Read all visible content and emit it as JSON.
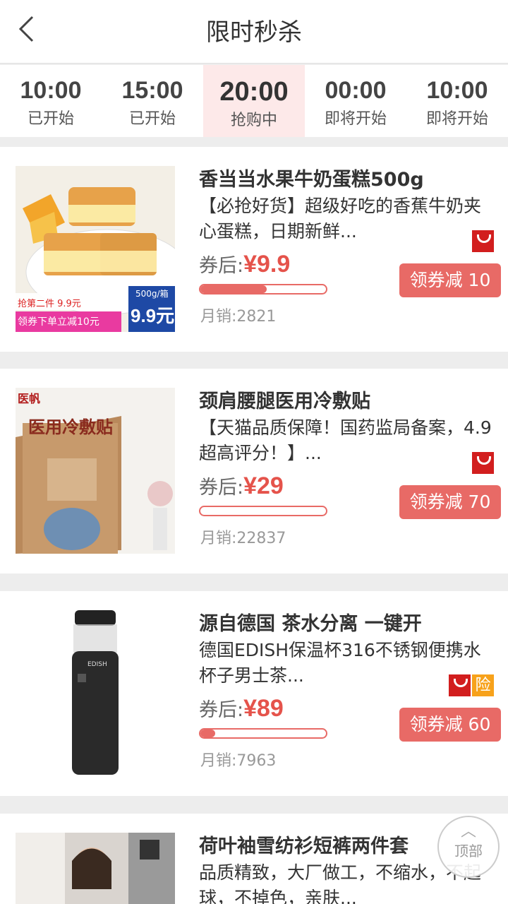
{
  "header": {
    "title": "限时秒杀"
  },
  "tabs": [
    {
      "time": "10:00",
      "status": "已开始"
    },
    {
      "time": "15:00",
      "status": "已开始"
    },
    {
      "time": "20:00",
      "status": "抢购中"
    },
    {
      "time": "00:00",
      "status": "即将开始"
    },
    {
      "time": "10:00",
      "status": "即将开始"
    }
  ],
  "products": [
    {
      "name": "香当当水果牛奶蛋糕500g",
      "desc": "【必抢好货】超级好吃的香蕉牛奶夹心蛋糕，日期新鲜...",
      "price_prefix": "券后:",
      "price": "¥9.9",
      "sales": "月销:2821",
      "coupon": "领券减 10",
      "progress": 0.53,
      "img_promo1": "抢第二件 9.9元",
      "img_promo2": "领券下单立减10元",
      "img_box": "500g/箱",
      "img_price": "9.9元"
    },
    {
      "name": "颈肩腰腿医用冷敷贴",
      "desc": "【天猫品质保障！国药监局备案，4.9超高评分！】...",
      "price_prefix": "券后:",
      "price": "¥29",
      "sales": "月销:22837",
      "coupon": "领券减 70",
      "progress": 0.0,
      "img_title": "医用冷敷贴",
      "img_brand": "医帆"
    },
    {
      "name": "源自德国 茶水分离 一键开",
      "desc": "德国EDISH保温杯316不锈钢便携水杯子男士茶...",
      "price_prefix": "券后:",
      "price": "¥89",
      "sales": "月销:7963",
      "coupon": "领券减 60",
      "progress": 0.12,
      "img_brand": "EDISH"
    },
    {
      "name": "荷叶袖雪纺衫短裤两件套",
      "desc": "品质精致，大厂做工，不缩水，不起球，不掉色，亲肤..."
    }
  ],
  "badges": {
    "insurance": "险"
  },
  "back_to_top": {
    "arrow": "︿",
    "label": "顶部"
  },
  "colors": {
    "accent": "#e86a66",
    "price": "#e5534b",
    "active_tab_bg": "#fde9e9"
  }
}
